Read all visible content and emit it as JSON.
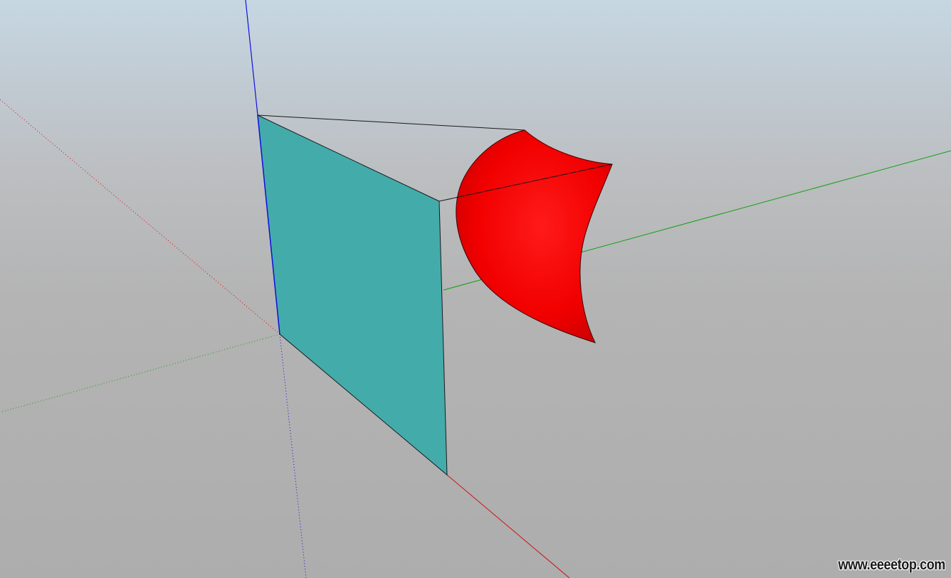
{
  "scene": {
    "background_top": "#c6d7e2",
    "background_bottom": "#adadad",
    "axes": {
      "red_axis_color": "#d01010",
      "green_axis_color": "#10a010",
      "blue_axis_color": "#1010e0"
    },
    "objects": [
      {
        "name": "teal-face",
        "fill": "#44abab",
        "edge": "#1a1a1a"
      },
      {
        "name": "red-curved-surface",
        "fill": "#ff0000",
        "edge": "#1a1a1a"
      }
    ]
  },
  "watermark": {
    "text": "www.eeeetop.com"
  }
}
